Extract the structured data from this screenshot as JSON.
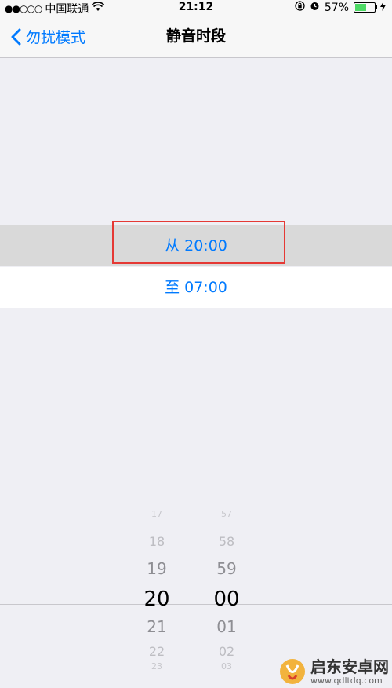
{
  "status_bar": {
    "carrier": "中国联通",
    "signal_dots": "●●○○○",
    "time": "21:12",
    "battery": "57%",
    "battery_level": 0.57
  },
  "nav": {
    "back_label": "勿扰模式",
    "title": "静音时段"
  },
  "rows": {
    "from_label": "从 20:00",
    "to_label": "至 07:00"
  },
  "picker": {
    "hours": [
      "17",
      "18",
      "19",
      "20",
      "21",
      "22",
      "23"
    ],
    "minutes": [
      "57",
      "58",
      "59",
      "00",
      "01",
      "02",
      "03"
    ],
    "selected_hour": "20",
    "selected_minute": "00"
  },
  "watermark": {
    "title": "启东安卓网",
    "url": "www.qdltdq.com"
  },
  "colors": {
    "accent": "#007aff",
    "highlight_border": "#e53935",
    "battery": "#4cd964"
  }
}
